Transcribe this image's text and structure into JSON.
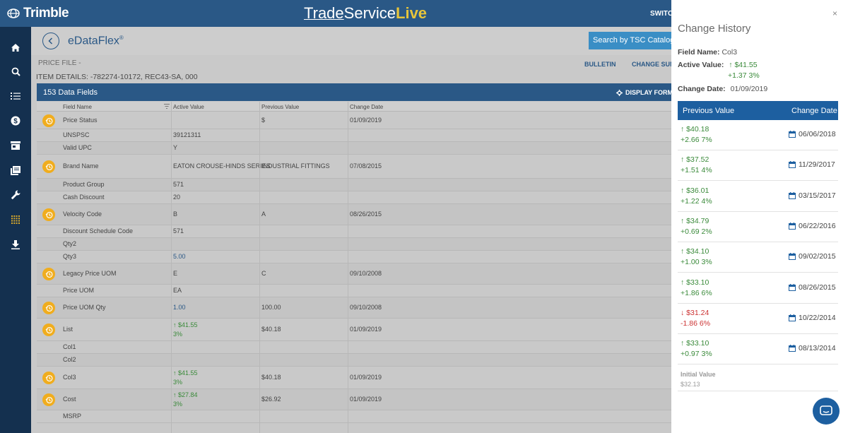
{
  "topbar": {
    "brand": "Trimble",
    "product_part1": "Trade",
    "product_part2": "Service",
    "product_part3": "Live",
    "switch_label": "SWITCH"
  },
  "sidebar": {
    "icons": [
      "home-icon",
      "search-icon",
      "list-icon",
      "dollar-icon",
      "store-icon",
      "catalog-icon",
      "wrench-icon",
      "grid-icon",
      "download-icon"
    ]
  },
  "app": {
    "title": "eDataFlex",
    "title_mark": "®",
    "search_placeholder": "Search by TSC Catalog N",
    "price_file": "PRICE FILE -",
    "item_details": "ITEM DETAILS: -782274-10172, REC43-SA, 000",
    "bulletin": "BULLETIN",
    "change_summary": "CHANGE SUM",
    "data_fields": "153  Data Fields",
    "display_format": "DISPLAY FORM"
  },
  "grid": {
    "columns": [
      "Field Name",
      "Active Value",
      "Previous Value",
      "Change Date"
    ],
    "rows": [
      {
        "history": true,
        "field": "Price Status",
        "active": "",
        "active_delta": "",
        "prev": "$",
        "date": "01/09/2019"
      },
      {
        "history": false,
        "field": "UNSPSC",
        "active": "39121311",
        "active_delta": "",
        "prev": "",
        "date": ""
      },
      {
        "history": false,
        "field": "Valid UPC",
        "active": "Y",
        "active_delta": "",
        "prev": "",
        "date": ""
      },
      {
        "history": true,
        "field": "Brand Name",
        "active": "EATON CROUSE-HINDS SERIES",
        "active_delta": "",
        "prev": "INDUSTRIAL FITTINGS",
        "date": "07/08/2015"
      },
      {
        "history": false,
        "field": "Product Group",
        "active": "571",
        "active_delta": "",
        "prev": "",
        "date": ""
      },
      {
        "history": false,
        "field": "Cash Discount",
        "active": "20",
        "active_delta": "",
        "prev": "",
        "date": ""
      },
      {
        "history": true,
        "field": "Velocity Code",
        "active": "B",
        "active_delta": "",
        "prev": "A",
        "date": "08/26/2015"
      },
      {
        "history": false,
        "field": "Discount Schedule Code",
        "active": "571",
        "active_delta": "",
        "prev": "",
        "date": ""
      },
      {
        "history": false,
        "field": "Qty2",
        "active": "",
        "active_delta": "",
        "prev": "",
        "date": ""
      },
      {
        "history": false,
        "field": "Qty3",
        "active": "5.00",
        "active_delta": "",
        "prev": "",
        "date": ""
      },
      {
        "history": true,
        "field": "Legacy Price UOM",
        "active": "E",
        "active_delta": "",
        "prev": "C",
        "date": "09/10/2008"
      },
      {
        "history": false,
        "field": "Price UOM",
        "active": "EA",
        "active_delta": "",
        "prev": "",
        "date": ""
      },
      {
        "history": true,
        "field": "Price UOM Qty",
        "active": "1.00",
        "active_delta": "",
        "prev": "100.00",
        "date": "09/10/2008"
      },
      {
        "history": true,
        "field": "List",
        "active": "↑ $41.55",
        "active_delta": "3%",
        "prev": "$40.18",
        "date": "01/09/2019"
      },
      {
        "history": false,
        "field": "Col1",
        "active": "",
        "active_delta": "",
        "prev": "",
        "date": ""
      },
      {
        "history": false,
        "field": "Col2",
        "active": "",
        "active_delta": "",
        "prev": "",
        "date": ""
      },
      {
        "history": true,
        "field": "Col3",
        "active": "↑ $41.55",
        "active_delta": "3%",
        "prev": "$40.18",
        "date": "01/09/2019"
      },
      {
        "history": true,
        "field": "Cost",
        "active": "↑ $27.84",
        "active_delta": "3%",
        "prev": "$26.92",
        "date": "01/09/2019"
      },
      {
        "history": false,
        "field": "MSRP",
        "active": "",
        "active_delta": "",
        "prev": "",
        "date": ""
      }
    ]
  },
  "panel": {
    "close": "×",
    "title": "Change History",
    "field_name_label": "Field Name:",
    "field_name": "Col3",
    "active_value_label": "Active Value:",
    "active_value": "↑ $41.55",
    "active_delta": "+1.37  3%",
    "change_date_label": "Change Date:",
    "change_date": "01/09/2019",
    "col_prev": "Previous Value",
    "col_date": "Change Date",
    "history": [
      {
        "value": "↑ $40.18",
        "delta": "+2.66  7%",
        "date": "06/06/2018",
        "dir": "up"
      },
      {
        "value": "↑ $37.52",
        "delta": "+1.51  4%",
        "date": "11/29/2017",
        "dir": "up"
      },
      {
        "value": "↑ $36.01",
        "delta": "+1.22  4%",
        "date": "03/15/2017",
        "dir": "up"
      },
      {
        "value": "↑ $34.79",
        "delta": "+0.69  2%",
        "date": "06/22/2016",
        "dir": "up"
      },
      {
        "value": "↑ $34.10",
        "delta": "+1.00  3%",
        "date": "09/02/2015",
        "dir": "up"
      },
      {
        "value": "↑ $33.10",
        "delta": "+1.86  6%",
        "date": "08/26/2015",
        "dir": "up"
      },
      {
        "value": "↓ $31.24",
        "delta": "-1.86  6%",
        "date": "10/22/2014",
        "dir": "down"
      },
      {
        "value": "↑ $33.10",
        "delta": "+0.97  3%",
        "date": "08/13/2014",
        "dir": "up"
      }
    ],
    "initial_label": "Initial Value",
    "initial_value": "$32.13"
  },
  "colors": {
    "brand_blue": "#2a5886",
    "panel_header": "#1d5fa0",
    "history_badge": "#f0ad1e",
    "up_green": "#3a8a3a",
    "down_red": "#cc3333"
  }
}
